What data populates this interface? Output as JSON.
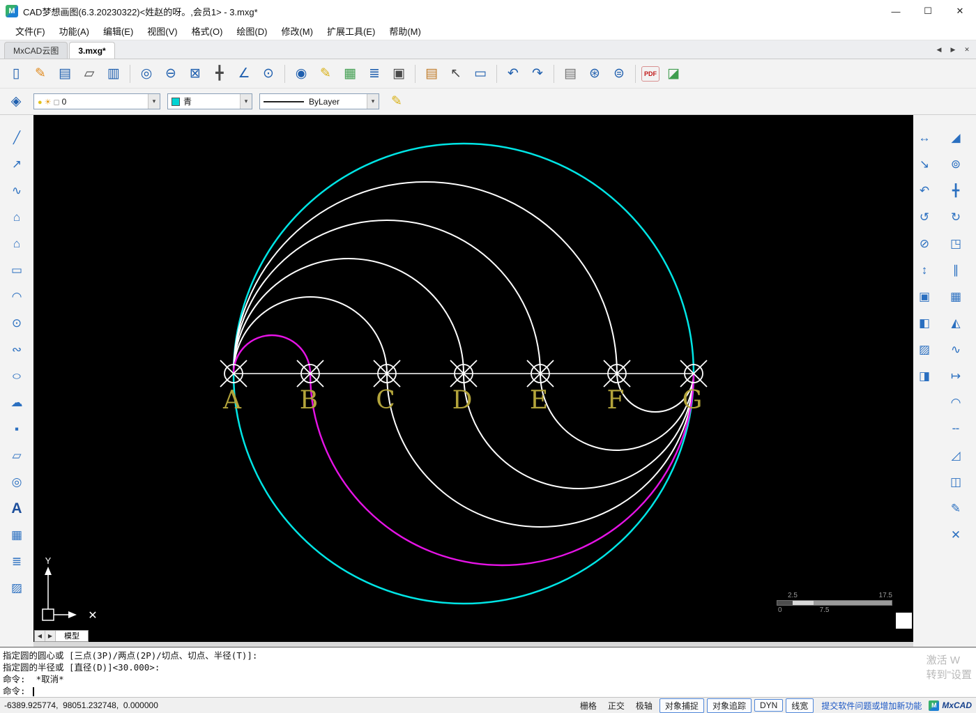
{
  "window": {
    "title": "CAD梦想画图(6.3.20230322)<姓赵的呀。,会员1> - 3.mxg*",
    "logo_glyph": "M",
    "controls": [
      {
        "name": "minimize-button",
        "glyph": "—"
      },
      {
        "name": "maximize-button",
        "glyph": "☐"
      },
      {
        "name": "close-button",
        "glyph": "✕"
      }
    ]
  },
  "menu": {
    "items": [
      {
        "label": "文件(F)",
        "name": "menu-file"
      },
      {
        "label": "功能(A)",
        "name": "menu-function"
      },
      {
        "label": "编辑(E)",
        "name": "menu-edit"
      },
      {
        "label": "视图(V)",
        "name": "menu-view"
      },
      {
        "label": "格式(O)",
        "name": "menu-format"
      },
      {
        "label": "绘图(D)",
        "name": "menu-draw"
      },
      {
        "label": "修改(M)",
        "name": "menu-modify"
      },
      {
        "label": "扩展工具(E)",
        "name": "menu-ext-tools"
      },
      {
        "label": "帮助(M)",
        "name": "menu-help"
      }
    ]
  },
  "tabs": {
    "items": [
      {
        "label": "MxCAD云图",
        "name": "tab-mxcad-cloud",
        "cls": ""
      },
      {
        "label": "3.mxg*",
        "name": "tab-3mxg",
        "cls": "active"
      }
    ],
    "nav": [
      {
        "name": "tab-prev-icon",
        "glyph": "◀"
      },
      {
        "name": "tab-next-icon",
        "glyph": "▶"
      },
      {
        "name": "tab-close-icon",
        "glyph": "✕"
      }
    ]
  },
  "toolbar_main": {
    "items": [
      {
        "name": "new-icon",
        "glyph": "▯",
        "cls": ""
      },
      {
        "name": "open-edit-icon",
        "glyph": "✎",
        "cls": "c-orange"
      },
      {
        "name": "save-icon",
        "glyph": "▤",
        "cls": ""
      },
      {
        "name": "open-folder-icon",
        "glyph": "▱",
        "cls": "c-dark"
      },
      {
        "name": "save-as-icon",
        "glyph": "▥",
        "cls": ""
      },
      {
        "name": "separator",
        "glyph": "",
        "cls": "sep"
      },
      {
        "name": "zoom-previous-icon",
        "glyph": "◎",
        "cls": ""
      },
      {
        "name": "zoom-out-icon",
        "glyph": "⊖",
        "cls": ""
      },
      {
        "name": "zoom-extents-icon",
        "glyph": "⊠",
        "cls": ""
      },
      {
        "name": "pan-icon",
        "glyph": "╋",
        "cls": "c-dark"
      },
      {
        "name": "ucs-icon",
        "glyph": "∠",
        "cls": ""
      },
      {
        "name": "zoom-realtime-icon",
        "glyph": "⊙",
        "cls": ""
      },
      {
        "name": "separator",
        "glyph": "",
        "cls": "sep"
      },
      {
        "name": "find-icon",
        "glyph": "◉",
        "cls": ""
      },
      {
        "name": "pencil-icon",
        "glyph": "✎",
        "cls": "c-yellow"
      },
      {
        "name": "table-icon",
        "glyph": "▦",
        "cls": "c-green"
      },
      {
        "name": "text-lines-icon",
        "glyph": "≣",
        "cls": ""
      },
      {
        "name": "block-icon",
        "glyph": "▣",
        "cls": "c-dark"
      },
      {
        "name": "separator",
        "glyph": "",
        "cls": "sep"
      },
      {
        "name": "layer-manager-icon",
        "glyph": "▤",
        "cls": "c-multi"
      },
      {
        "name": "select-icon",
        "glyph": "↖",
        "cls": "c-dark"
      },
      {
        "name": "layout-edit-icon",
        "glyph": "▭",
        "cls": ""
      },
      {
        "name": "separator",
        "glyph": "",
        "cls": "sep"
      },
      {
        "name": "undo-icon",
        "glyph": "↶",
        "cls": ""
      },
      {
        "name": "redo-icon",
        "glyph": "↷",
        "cls": ""
      },
      {
        "name": "separator",
        "glyph": "",
        "cls": "sep"
      },
      {
        "name": "print-icon",
        "glyph": "▤",
        "cls": "c-gray"
      },
      {
        "name": "web-publish-icon",
        "glyph": "⊛",
        "cls": ""
      },
      {
        "name": "web-browser-icon",
        "glyph": "⊜",
        "cls": ""
      },
      {
        "name": "separator",
        "glyph": "",
        "cls": "sep"
      },
      {
        "name": "pdf-export-icon",
        "glyph": "PDF",
        "cls": "pdf"
      },
      {
        "name": "image-export-icon",
        "glyph": "◪",
        "cls": "c-green"
      }
    ]
  },
  "ui": {
    "dropdown_arrow": "▾"
  },
  "props": {
    "layers_glyph": "◈",
    "pencil_glyph": "✎",
    "layer": {
      "value": "0",
      "icons": [
        {
          "name": "bulb-icon",
          "glyph": "●",
          "cls": "c-bulb"
        },
        {
          "name": "sun-icon",
          "glyph": "☀",
          "cls": "c-sun"
        },
        {
          "name": "lock-icon",
          "glyph": "◻",
          "cls": "c-lock"
        }
      ]
    },
    "color": {
      "value": "青",
      "swatch": "#00d4d4"
    },
    "linetype": {
      "value": "ByLayer"
    }
  },
  "left_toolbar": {
    "items": [
      {
        "name": "line-icon",
        "glyph": "╱",
        "cls": ""
      },
      {
        "name": "xline-icon",
        "glyph": "↗",
        "cls": ""
      },
      {
        "name": "polyline-icon",
        "glyph": "∿",
        "cls": ""
      },
      {
        "name": "polygon-filled-icon",
        "glyph": "⌂",
        "cls": "c-fill"
      },
      {
        "name": "polygon-icon",
        "glyph": "⌂",
        "cls": ""
      },
      {
        "name": "rectangle-icon",
        "glyph": "▭",
        "cls": ""
      },
      {
        "name": "arc-icon",
        "glyph": "◠",
        "cls": ""
      },
      {
        "name": "circle-icon",
        "glyph": "⊙",
        "cls": ""
      },
      {
        "name": "spline-icon",
        "glyph": "∾",
        "cls": ""
      },
      {
        "name": "ellipse-icon",
        "glyph": "○",
        "cls": "wide"
      },
      {
        "name": "revcloud-icon",
        "glyph": "☁",
        "cls": ""
      },
      {
        "name": "point-icon",
        "glyph": "▪",
        "cls": ""
      },
      {
        "name": "region-icon",
        "glyph": "▱",
        "cls": ""
      },
      {
        "name": "donut-icon",
        "glyph": "◎",
        "cls": ""
      },
      {
        "name": "text-icon",
        "glyph": "A",
        "cls": "big"
      },
      {
        "name": "image-icon",
        "glyph": "▦",
        "cls": ""
      },
      {
        "name": "mtext-icon",
        "glyph": "≣",
        "cls": ""
      },
      {
        "name": "hatch-icon",
        "glyph": "▨",
        "cls": ""
      }
    ]
  },
  "right_toolbar": {
    "inner": [
      {
        "name": "dim-linear-icon",
        "glyph": "↔",
        "cls": ""
      },
      {
        "name": "dim-aligned-icon",
        "glyph": "↘",
        "cls": ""
      },
      {
        "name": "dim-angular-icon",
        "glyph": "↶",
        "cls": ""
      },
      {
        "name": "dim-radius-icon",
        "glyph": "↺",
        "cls": ""
      },
      {
        "name": "dim-diameter-icon",
        "glyph": "⊘",
        "cls": ""
      },
      {
        "name": "dim-continue-icon",
        "glyph": "↕",
        "cls": ""
      },
      {
        "name": "array-rect-icon",
        "glyph": "▣",
        "cls": "c-fill"
      },
      {
        "name": "block-editor-icon",
        "glyph": "◧",
        "cls": "c-fill"
      },
      {
        "name": "hatch-pattern-icon",
        "glyph": "▨",
        "cls": ""
      },
      {
        "name": "gradient-fill-icon",
        "glyph": "◨",
        "cls": "c-fill"
      }
    ],
    "outer": [
      {
        "name": "erase-icon",
        "glyph": "◢",
        "cls": "c-orange"
      },
      {
        "name": "copy-icon",
        "glyph": "⊚",
        "cls": ""
      },
      {
        "name": "move-icon",
        "glyph": "╋",
        "cls": ""
      },
      {
        "name": "rotate-icon",
        "glyph": "↻",
        "cls": ""
      },
      {
        "name": "scale-icon",
        "glyph": "◳",
        "cls": ""
      },
      {
        "name": "offset-icon",
        "glyph": "∥",
        "cls": ""
      },
      {
        "name": "array-icon",
        "glyph": "▦",
        "cls": ""
      },
      {
        "name": "mirror-icon",
        "glyph": "◭",
        "cls": ""
      },
      {
        "name": "trim-icon",
        "glyph": "∿",
        "cls": ""
      },
      {
        "name": "stretch-icon",
        "glyph": "↦",
        "cls": ""
      },
      {
        "name": "fillet-icon",
        "glyph": "◠",
        "cls": ""
      },
      {
        "name": "break-icon",
        "glyph": "╌",
        "cls": ""
      },
      {
        "name": "chamfer-icon",
        "glyph": "◿",
        "cls": ""
      },
      {
        "name": "box-3d-icon",
        "glyph": "◫",
        "cls": ""
      },
      {
        "name": "edit-poly-icon",
        "glyph": "✎",
        "cls": ""
      },
      {
        "name": "explode-icon",
        "glyph": "✕",
        "cls": "c-cyan"
      }
    ]
  },
  "canvas": {
    "labels": [
      "A",
      "B",
      "C",
      "D",
      "E",
      "F",
      "G"
    ],
    "label_color": "#b3a43b",
    "circle_color": "#00e5e5",
    "curve_color": "#ffffff",
    "accent_curve_color": "#e613e6",
    "ucs": {
      "y": "Y",
      "x": "✕"
    },
    "scalebar": {
      "tl": "2.5",
      "tr": "17.5",
      "bl": "0",
      "bm": "7.5"
    }
  },
  "model_strip": {
    "left": "◀",
    "right": "▶",
    "tab": "模型"
  },
  "command": {
    "lines": [
      "指定圆的圆心或 [三点(3P)/两点(2P)/切点、切点、半径(T)]:",
      "指定圆的半径或 [直径(D)]<30.000>:",
      "命令:  *取消*"
    ],
    "prompt": "命令: "
  },
  "watermark": {
    "line1": "激活 W",
    "line2": "转到\"设置"
  },
  "status": {
    "coords": "-6389.925774,  98051.232748,  0.000000",
    "toggles": [
      {
        "label": "栅格",
        "name": "toggle-grid",
        "cls": ""
      },
      {
        "label": "正交",
        "name": "toggle-ortho",
        "cls": ""
      },
      {
        "label": "极轴",
        "name": "toggle-polar",
        "cls": ""
      },
      {
        "label": "对象捕捉",
        "name": "toggle-osnap",
        "cls": "boxed"
      },
      {
        "label": "对象追踪",
        "name": "toggle-otrack",
        "cls": "boxed"
      },
      {
        "label": "DYN",
        "name": "toggle-dyn",
        "cls": "boxed"
      },
      {
        "label": "线宽",
        "name": "toggle-lineweight",
        "cls": "boxed"
      }
    ],
    "link": "提交软件问题或增加新功能",
    "brand": "MxCAD",
    "brand_glyph": "M"
  }
}
